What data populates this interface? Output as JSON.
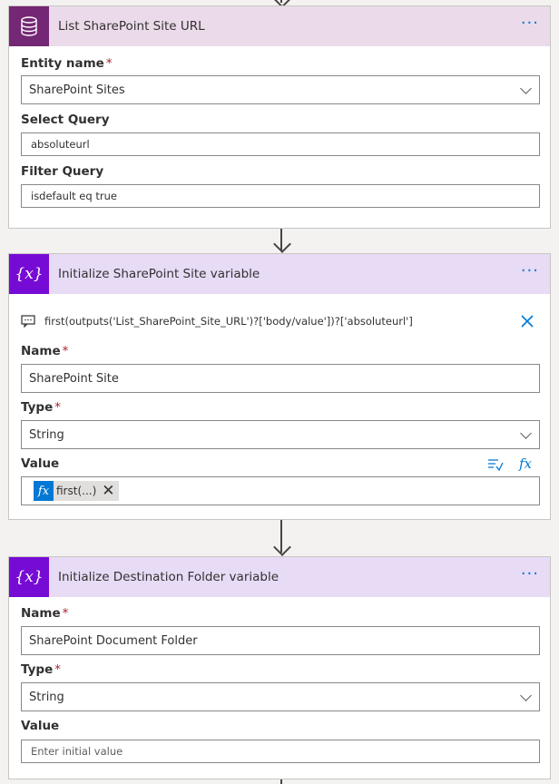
{
  "cards": [
    {
      "title": "List SharePoint Site URL",
      "fields": {
        "entity_label": "Entity name",
        "entity_value": "SharePoint Sites",
        "select_label": "Select Query",
        "select_value": "absoluteurl",
        "filter_label": "Filter Query",
        "filter_value": "isdefault eq true"
      }
    },
    {
      "title": "Initialize SharePoint Site variable",
      "expression": "first(outputs('List_SharePoint_Site_URL')?['body/value'])?['absoluteurl']",
      "fields": {
        "name_label": "Name",
        "name_value": "SharePoint Site",
        "type_label": "Type",
        "type_value": "String",
        "value_label": "Value",
        "token_fx": "fx",
        "token_text": "first(...)"
      }
    },
    {
      "title": "Initialize Destination Folder variable",
      "fields": {
        "name_label": "Name",
        "name_value": "SharePoint Document Folder",
        "type_label": "Type",
        "type_value": "String",
        "value_label": "Value",
        "value_placeholder": "Enter initial value"
      }
    }
  ],
  "common": {
    "more": "···",
    "required_mark": "*",
    "variable_icon_glyph": "{x}",
    "fx_button": "fx",
    "close_glyph": "✕"
  },
  "colors": {
    "dataverse_purple": "#742774",
    "variable_purple": "#770bd6",
    "dataverse_header": "#ebdbea",
    "variable_header": "#e8dbf6",
    "link_blue": "#0078d4"
  },
  "icons": {
    "card1": "database-icon",
    "card2": "variable-icon",
    "card3": "variable-icon",
    "expression": "comment-icon",
    "dynamic_content": "dynamic-content-icon"
  }
}
